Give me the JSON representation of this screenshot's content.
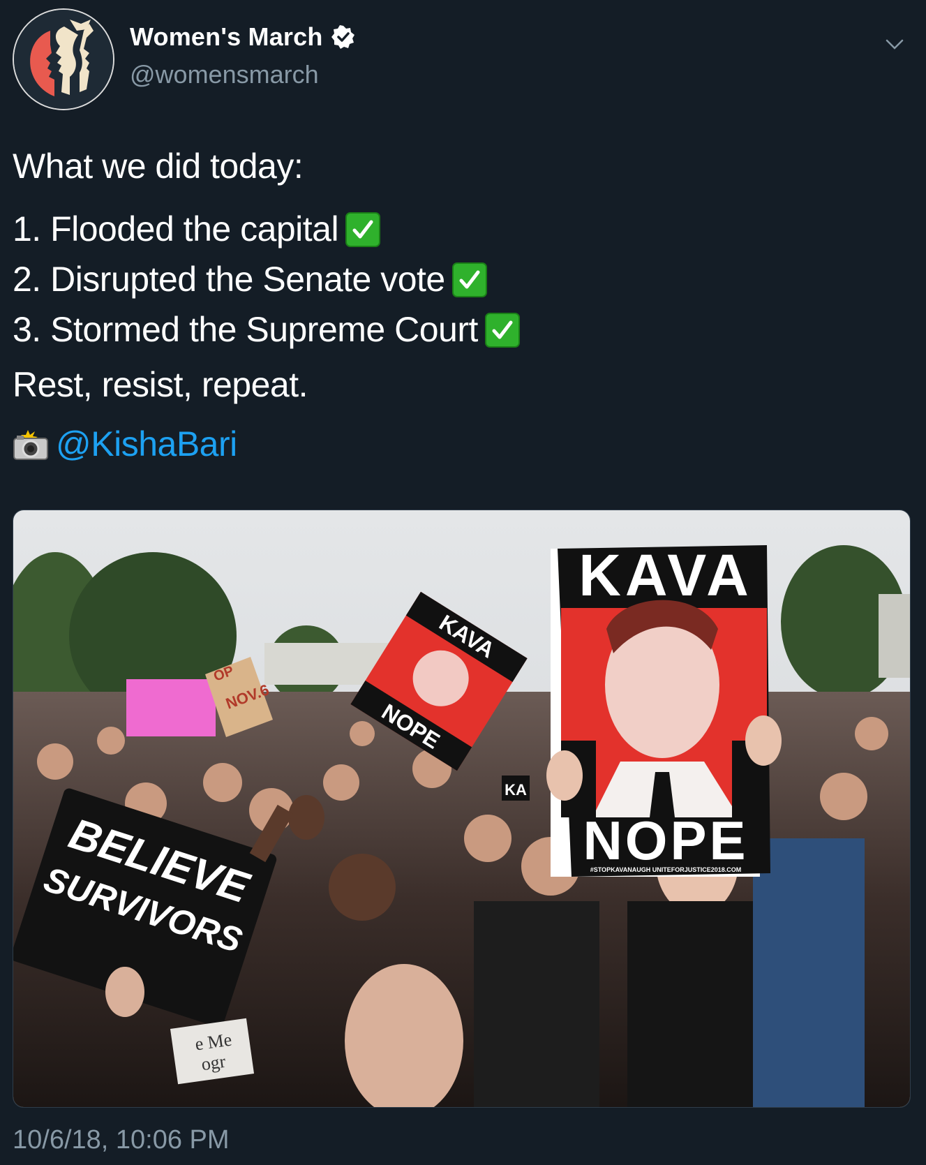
{
  "account": {
    "display_name": "Women's March",
    "handle": "@womensmarch",
    "verified": true,
    "avatar_icon": "womens-march-logo-icon"
  },
  "tweet": {
    "intro": "What we did today:",
    "items": [
      {
        "text": "1. Flooded the capital",
        "icon": "check-mark-emoji"
      },
      {
        "text": "2. Disrupted the Senate vote",
        "icon": "check-mark-emoji"
      },
      {
        "text": "3. Stormed the Supreme Court",
        "icon": "check-mark-emoji"
      }
    ],
    "closing": "Rest, resist, repeat.",
    "credit_icon": "camera-flash-emoji",
    "credit_mention": "@KishaBari"
  },
  "photo": {
    "signs": {
      "big_top": "KAVA",
      "big_bottom": "NOPE",
      "big_footer": "#STOPKAVANAUGH   UNITEFORJUSTICE2018.COM",
      "small_top": "KAVA",
      "small_bottom": "NOPE",
      "believe_1": "BELIEVE",
      "believe_2": "SURVIVORS",
      "vote_date": "NOV.6",
      "small_ka": "KA",
      "sign_me": "e Me",
      "sign_ogr": "ogr",
      "sign_op": "OP"
    }
  },
  "timestamp": "10/6/18, 10:06 PM",
  "colors": {
    "background": "#141d26",
    "link": "#1da1f2",
    "secondary_text": "#8899a6",
    "check_green": "#2fb12c"
  }
}
